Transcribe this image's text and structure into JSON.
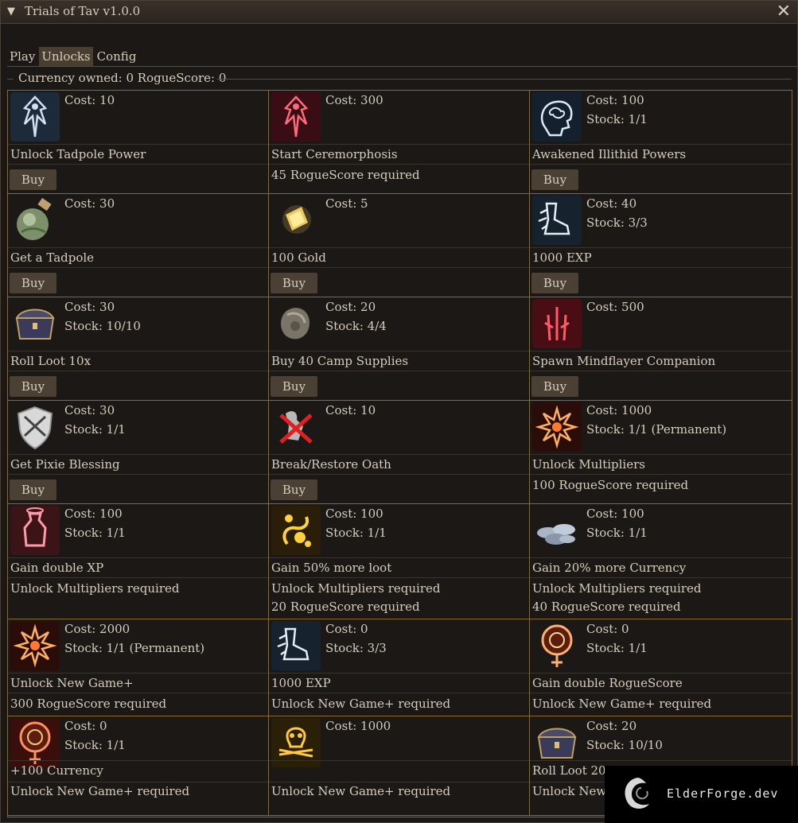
{
  "window": {
    "title": "Trials of Tav v1.0.0"
  },
  "tabs": [
    {
      "label": "Play"
    },
    {
      "label": "Unlocks"
    },
    {
      "label": "Config"
    }
  ],
  "status": {
    "text": "Currency owned: 0  RogueScore: 0"
  },
  "buy_label": "Buy",
  "items": [
    {
      "icon": "tadpole-power-icon",
      "cost": "Cost: 10",
      "stock": "",
      "name": "Unlock Tadpole Power",
      "req1": "",
      "req2": "",
      "buy": true
    },
    {
      "icon": "ceremorphosis-icon",
      "cost": "Cost: 300",
      "stock": "",
      "name": "Start Ceremorphosis",
      "req1": "45 RogueScore required",
      "req2": "",
      "buy": false
    },
    {
      "icon": "illithid-brain-icon",
      "cost": "Cost: 100",
      "stock": "Stock: 1/1",
      "name": "Awakened Illithid Powers",
      "req1": "",
      "req2": "",
      "buy": true
    },
    {
      "icon": "tadpole-jar-icon",
      "cost": "Cost: 30",
      "stock": "",
      "name": "Get a Tadpole",
      "req1": "",
      "req2": "",
      "buy": true
    },
    {
      "icon": "gold-icon",
      "cost": "Cost: 5",
      "stock": "",
      "name": "100 Gold",
      "req1": "",
      "req2": "",
      "buy": true
    },
    {
      "icon": "exp-boot-icon",
      "cost": "Cost: 40",
      "stock": "Stock: 3/3",
      "name": "1000 EXP",
      "req1": "",
      "req2": "",
      "buy": true
    },
    {
      "icon": "loot-chest-icon",
      "cost": "Cost: 30",
      "stock": "Stock: 10/10",
      "name": "Roll Loot 10x",
      "req1": "",
      "req2": "",
      "buy": true
    },
    {
      "icon": "camp-supplies-icon",
      "cost": "Cost: 20",
      "stock": "Stock: 4/4",
      "name": "Buy 40 Camp Supplies",
      "req1": "",
      "req2": "",
      "buy": true
    },
    {
      "icon": "mindflayer-icon",
      "cost": "Cost: 500",
      "stock": "",
      "name": "Spawn Mindflayer Companion",
      "req1": "",
      "req2": "",
      "buy": true
    },
    {
      "icon": "pixie-shield-icon",
      "cost": "Cost: 30",
      "stock": "Stock: 1/1",
      "name": "Get Pixie Blessing",
      "req1": "",
      "req2": "",
      "buy": true
    },
    {
      "icon": "broken-oath-icon",
      "cost": "Cost: 10",
      "stock": "",
      "name": "Break/Restore Oath",
      "req1": "",
      "req2": "",
      "buy": true
    },
    {
      "icon": "multiplier-burst-icon",
      "cost": "Cost: 1000",
      "stock": "Stock: 1/1 (Permanent)",
      "name": "Unlock Multipliers",
      "req1": "100 RogueScore required",
      "req2": "",
      "buy": false
    },
    {
      "icon": "xp-potion-icon",
      "cost": "Cost: 100",
      "stock": "Stock: 1/1",
      "name": "Gain double XP",
      "req1": "Unlock Multipliers required",
      "req2": "",
      "buy": false
    },
    {
      "icon": "loot-gold-icon",
      "cost": "Cost: 100",
      "stock": "Stock: 1/1",
      "name": "Gain 50% more loot",
      "req1": "Unlock Multipliers required",
      "req2": "20 RogueScore required",
      "buy": false
    },
    {
      "icon": "coins-icon",
      "cost": "Cost: 100",
      "stock": "Stock: 1/1",
      "name": "Gain 20% more Currency",
      "req1": "Unlock Multipliers required",
      "req2": "40 RogueScore required",
      "buy": false
    },
    {
      "icon": "new-game-burst-icon",
      "cost": "Cost: 2000",
      "stock": "Stock: 1/1 (Permanent)",
      "name": "Unlock New Game+",
      "req1": "300 RogueScore required",
      "req2": "",
      "buy": false
    },
    {
      "icon": "exp-boot-icon",
      "cost": "Cost: 0",
      "stock": "Stock: 3/3",
      "name": "1000 EXP",
      "req1": "Unlock New Game+ required",
      "req2": "",
      "buy": false
    },
    {
      "icon": "sun-flower-icon",
      "cost": "Cost: 0",
      "stock": "Stock: 1/1",
      "name": "Gain double RogueScore",
      "req1": "Unlock New Game+ required",
      "req2": "",
      "buy": false
    },
    {
      "icon": "sun-flower-red-icon",
      "cost": "Cost: 0",
      "stock": "Stock: 1/1",
      "name": "+100 Currency",
      "req1": "Unlock New Game+ required",
      "req2": "",
      "buy": false
    },
    {
      "icon": "skull-icon",
      "cost": "Cost: 1000",
      "stock": "",
      "name": "",
      "req1": "Unlock New Game+ required",
      "req2": "",
      "buy": false
    },
    {
      "icon": "loot-chest-icon",
      "cost": "Cost: 20",
      "stock": "Stock: 10/10",
      "name": "Roll Loot 20x",
      "req1": "Unlock New G",
      "req2": "",
      "buy": false
    }
  ],
  "watermark": {
    "text": "ElderForge.dev"
  }
}
